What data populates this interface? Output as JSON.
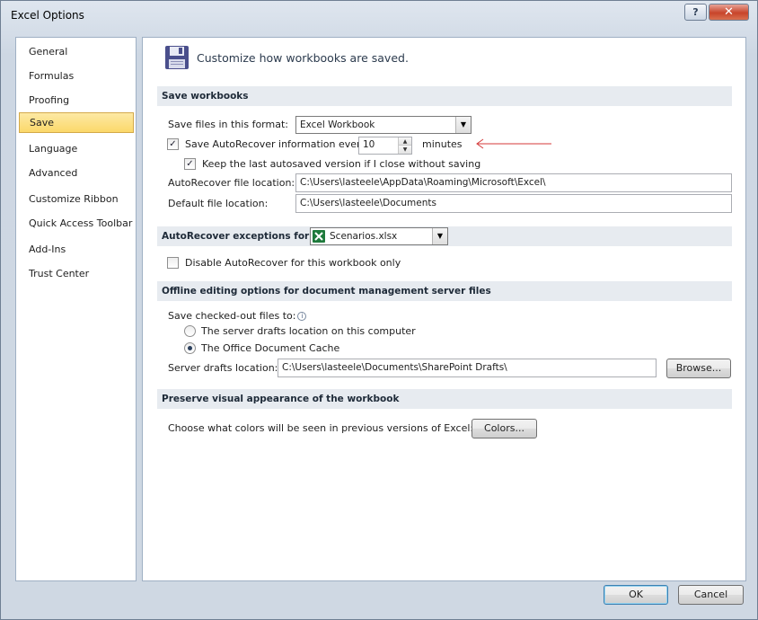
{
  "window": {
    "title": "Excel Options",
    "help_label": "?",
    "close_label": "✕"
  },
  "sidebar": {
    "items": [
      {
        "label": "General"
      },
      {
        "label": "Formulas"
      },
      {
        "label": "Proofing"
      },
      {
        "label": "Save",
        "active": true
      },
      {
        "label": "Language"
      },
      {
        "label": "Advanced"
      },
      {
        "label": "Customize Ribbon"
      },
      {
        "label": "Quick Access Toolbar"
      },
      {
        "label": "Add-Ins"
      },
      {
        "label": "Trust Center"
      }
    ]
  },
  "header": {
    "icon": "floppy-disk-icon",
    "text": "Customize how workbooks are saved."
  },
  "save_workbooks": {
    "title": "Save workbooks",
    "format_label": "Save files in this format:",
    "format_value": "Excel Workbook",
    "autorecover_label": "Save AutoRecover information every",
    "autorecover_checked": true,
    "autorecover_minutes": "10",
    "minutes_label": "minutes",
    "keep_last_label": "Keep the last autosaved version if I close without saving",
    "keep_last_checked": true,
    "autorecover_location_label": "AutoRecover file location:",
    "autorecover_location_value": "C:\\Users\\lasteele\\AppData\\Roaming\\Microsoft\\Excel\\",
    "default_location_label": "Default file location:",
    "default_location_value": "C:\\Users\\lasteele\\Documents"
  },
  "autorecover_exceptions": {
    "title": "AutoRecover exceptions for:",
    "workbook_value": "Scenarios.xlsx",
    "workbook_icon": "excel-file-icon",
    "disable_label": "Disable AutoRecover for this workbook only",
    "disable_checked": false
  },
  "offline_editing": {
    "title": "Offline editing options for document management server files",
    "save_checked_out_label": "Save checked-out files to:",
    "option_server_label": "The server drafts location on this computer",
    "option_cache_label": "The Office Document Cache",
    "selected_option": "The Office Document Cache",
    "server_drafts_label": "Server drafts location:",
    "server_drafts_value": "C:\\Users\\lasteele\\Documents\\SharePoint Drafts\\",
    "browse_label": "Browse..."
  },
  "preserve_visual": {
    "title": "Preserve visual appearance of the workbook",
    "colors_label": "Choose what colors will be seen in previous versions of Excel:",
    "colors_button": "Colors..."
  },
  "footer": {
    "ok_label": "OK",
    "cancel_label": "Cancel"
  },
  "colors": {
    "active_nav": "#fbd86a",
    "section_bg": "#e7ebf0",
    "annotation_arrow": "#d43a3a"
  }
}
